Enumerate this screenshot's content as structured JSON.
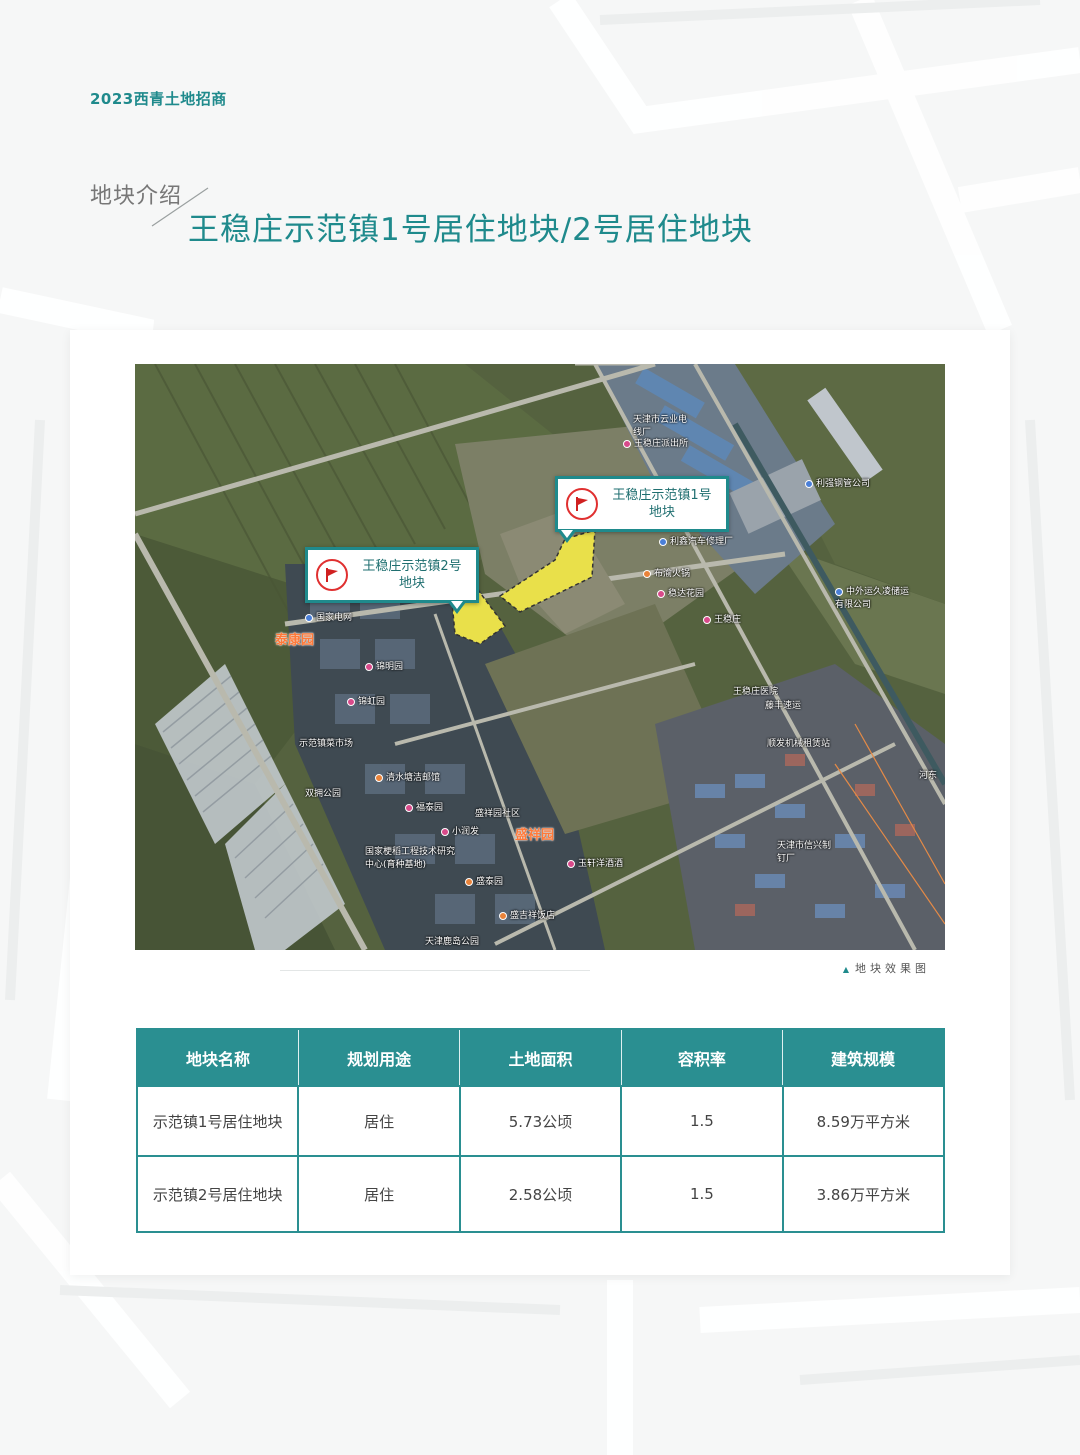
{
  "header": {
    "brand": "2023西青土地招商",
    "section_label": "地块介绍",
    "title": "王稳庄示范镇1号居住地块/2号居住地块"
  },
  "map": {
    "caption": "地块效果图",
    "pins": {
      "plot1": "王稳庄示范镇1号地块",
      "plot2": "王稳庄示范镇2号地块"
    },
    "areas": {
      "taikang": "泰康园",
      "shengxiang": "盛祥园"
    },
    "pois": {
      "cable": "天津市云业电线厂",
      "police": "王稳庄派出所",
      "steel": "利强钢管公司",
      "repair": "利鑫汽车修理厂",
      "hotpot": "布渝火锅",
      "wenda": "稳达花园",
      "wwz": "王稳庄",
      "logistics": "中外运久凌储运有限公司",
      "grid": "国家电网",
      "jinming": "锦明园",
      "jinhong": "锦虹园",
      "market": "示范镇菜市场",
      "qingshui": "清水塘洁邮馆",
      "shuangyong": "双拥公园",
      "futai": "福泰园",
      "shengxiang_comm": "盛祥园社区",
      "xiaorunfa": "小润发",
      "tech": "国家梗稻工程技术研究中心(育种基地)",
      "shengtai": "盛泰园",
      "hospital": "王稳庄医院",
      "fengtai": "藤丰速运",
      "machinery": "顺发机械租赁站",
      "yuxuan": "玉轩洋酒酒",
      "hotel": "盛吉祥饭店",
      "park": "天津鹿岛公园",
      "factory": "天津市信兴制钉厂",
      "hedong": "河东"
    },
    "colors": {
      "plot_fill": "#e9e04a",
      "accent": "#1f8a8c"
    }
  },
  "table": {
    "headers": [
      "地块名称",
      "规划用途",
      "土地面积",
      "容积率",
      "建筑规模"
    ],
    "rows": [
      [
        "示范镇1号居住地块",
        "居住",
        "5.73公顷",
        "1.5",
        "8.59万平方米"
      ],
      [
        "示范镇2号居住地块",
        "居住",
        "2.58公顷",
        "1.5",
        "3.86万平方米"
      ]
    ]
  }
}
